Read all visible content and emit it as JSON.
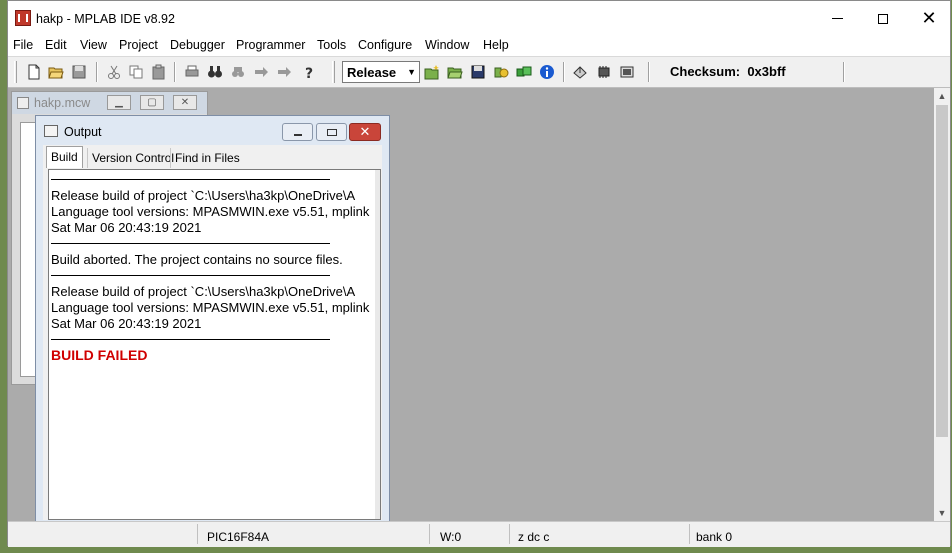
{
  "window": {
    "title": "hakp - MPLAB IDE v8.92"
  },
  "menu": [
    "File",
    "Edit",
    "View",
    "Project",
    "Debugger",
    "Programmer",
    "Tools",
    "Configure",
    "Window",
    "Help"
  ],
  "toolbar": {
    "build_config": "Release",
    "checksum_label": "Checksum:",
    "checksum_value": "0x3bff"
  },
  "mcw_window": {
    "title": "hakp.mcw"
  },
  "output_window": {
    "title": "Output",
    "tabs": [
      "Build",
      "Version Control",
      "Find in Files"
    ],
    "active_tab": "Build",
    "log": {
      "l1": "Release build of project `C:\\Users\\ha3kp\\OneDrive\\A",
      "l2": "Language tool versions: MPASMWIN.exe v5.51, mplink",
      "l3": "Sat Mar 06 20:43:19 2021",
      "l4": "Build aborted.  The project contains no source files.",
      "l5": "Release build of project `C:\\Users\\ha3kp\\OneDrive\\A",
      "l6": "Language tool versions: MPASMWIN.exe v5.51, mplink",
      "l7": "Sat Mar 06 20:43:19 2021",
      "result": "BUILD FAILED"
    }
  },
  "status": {
    "device": "PIC16F84A",
    "w_reg": "W:0",
    "flags": "z dc c",
    "bank": "bank 0"
  },
  "colors": {
    "fail": "#d00000",
    "mdi_bg": "#ababab"
  }
}
